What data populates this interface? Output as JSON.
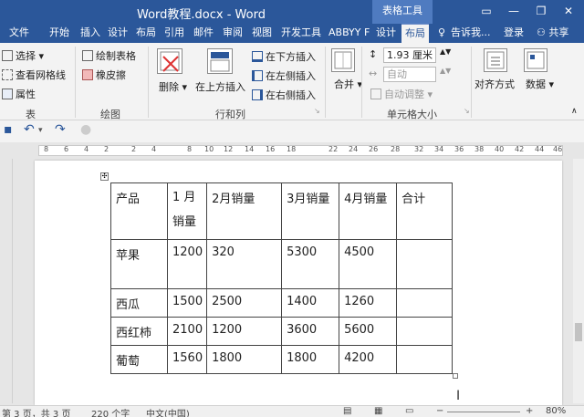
{
  "window": {
    "title": "Word教程.docx - Word",
    "context_tab_group": "表格工具",
    "minimize_glyph": "—",
    "restore_glyph": "❐",
    "close_glyph": "✕"
  },
  "tabs": [
    "文件",
    "开始",
    "插入",
    "设计",
    "布局",
    "引用",
    "邮件",
    "审阅",
    "视图",
    "开发工具",
    "ABBYY F",
    "设计",
    "布局"
  ],
  "tell_me": "告诉我...",
  "login": "登录",
  "share": "共享",
  "ribbon": {
    "table_group": {
      "select": "选择",
      "gridlines": "查看网格线",
      "properties": "属性",
      "label": "表"
    },
    "draw_group": {
      "draw_table": "绘制表格",
      "eraser": "橡皮擦",
      "label": "绘图"
    },
    "rows_cols_group": {
      "delete": "删除",
      "insert_above": "在上方插入",
      "insert_below": "在下方插入",
      "insert_left": "在左侧插入",
      "insert_right": "在右侧插入",
      "label": "行和列"
    },
    "merge_group": {
      "merge": "合并"
    },
    "cell_size_group": {
      "height_value": "1.93 厘米",
      "width_value": "自动",
      "autofit": "自动调整",
      "label": "单元格大小"
    },
    "alignment_group": {
      "label": "对齐方式"
    },
    "data_group": {
      "label": "数据"
    }
  },
  "ruler_numbers": [
    "8",
    "6",
    "4",
    "2",
    "2",
    "4",
    "8",
    "10",
    "12",
    "14",
    "16",
    "18",
    "22",
    "24",
    "26",
    "28",
    "32",
    "34",
    "36",
    "38",
    "40",
    "42",
    "44",
    "46"
  ],
  "table": {
    "rows": [
      [
        "产品",
        "1 月销量",
        "2月销量",
        "3月销量",
        "4月销量",
        "合计"
      ],
      [
        "苹果",
        "1200",
        "320",
        "5300",
        "4500",
        ""
      ],
      [
        "西瓜",
        "1500",
        "2500",
        "1400",
        "1260",
        ""
      ],
      [
        "西红柿",
        "2100",
        "1200",
        "3600",
        "5600",
        ""
      ],
      [
        "葡萄",
        "1560",
        "1800",
        "1800",
        "4200",
        ""
      ]
    ]
  },
  "status": {
    "page": "第 3 页，共 3 页",
    "words": "220 个字",
    "language": "中文(中国)",
    "zoom": "80%"
  }
}
